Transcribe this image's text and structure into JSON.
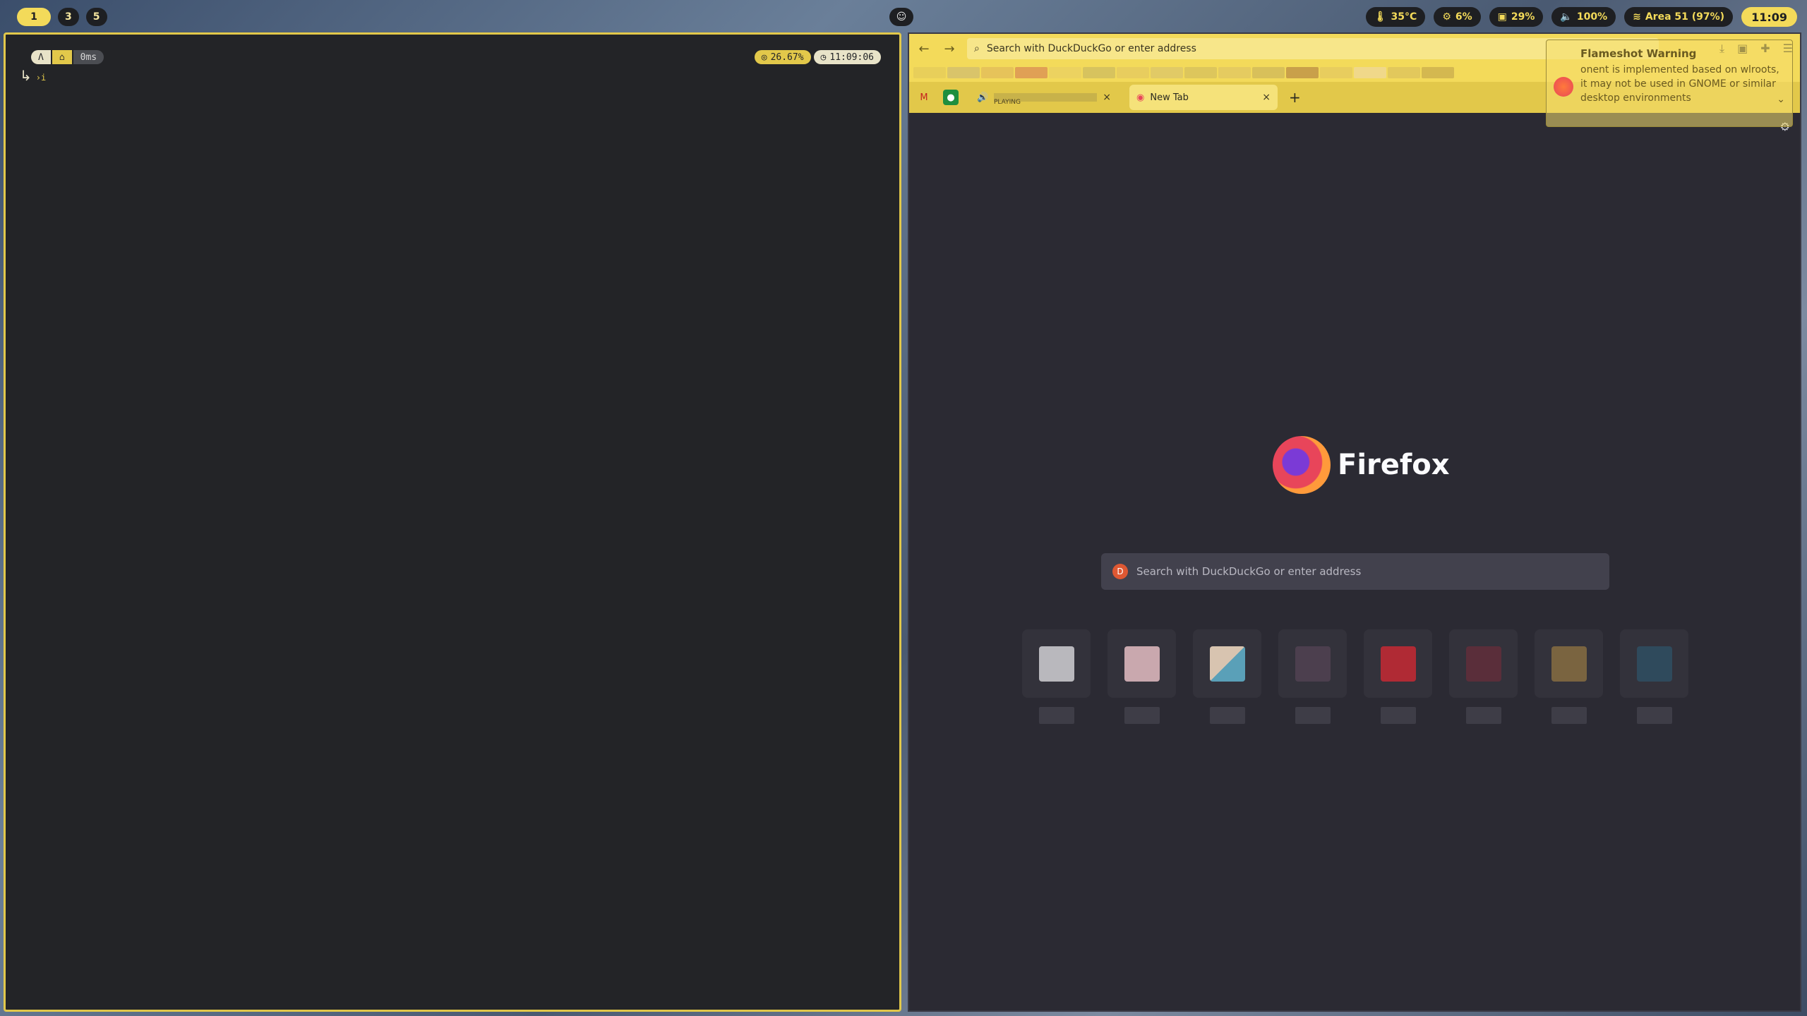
{
  "topbar": {
    "workspaces": [
      "1",
      "3",
      "5"
    ],
    "status": {
      "temp": "35°C",
      "cpu": "6%",
      "disk": "29%",
      "volume": "100%",
      "wifi": "Area 51 (97%)",
      "clock": "11:09"
    }
  },
  "terminal": {
    "prompt": {
      "arch_glyph": "Λ",
      "home_glyph": "⌂",
      "duration": "0ms",
      "cpu_usage": "26.67%",
      "time": "11:09:06"
    },
    "cursor": "›i"
  },
  "firefox": {
    "nav": {
      "back": "←",
      "forward": "→",
      "url_placeholder": "Search with DuckDuckGo or enter address"
    },
    "tabs": {
      "playing_label": "PLAYING",
      "active_title": "New Tab",
      "close": "×",
      "new": "+"
    },
    "newtab": {
      "brand": "Firefox",
      "search_placeholder": "Search with DuckDuckGo or enter address"
    }
  },
  "notification": {
    "title": "Flameshot Warning",
    "body_fragment": "onent is implemented based on wlroots, it may not be used in GNOME or similar desktop environments"
  },
  "colors": {
    "accent": "#f3da5a",
    "terminal_bg": "#232427",
    "firefox_bg": "#2b2a33"
  }
}
